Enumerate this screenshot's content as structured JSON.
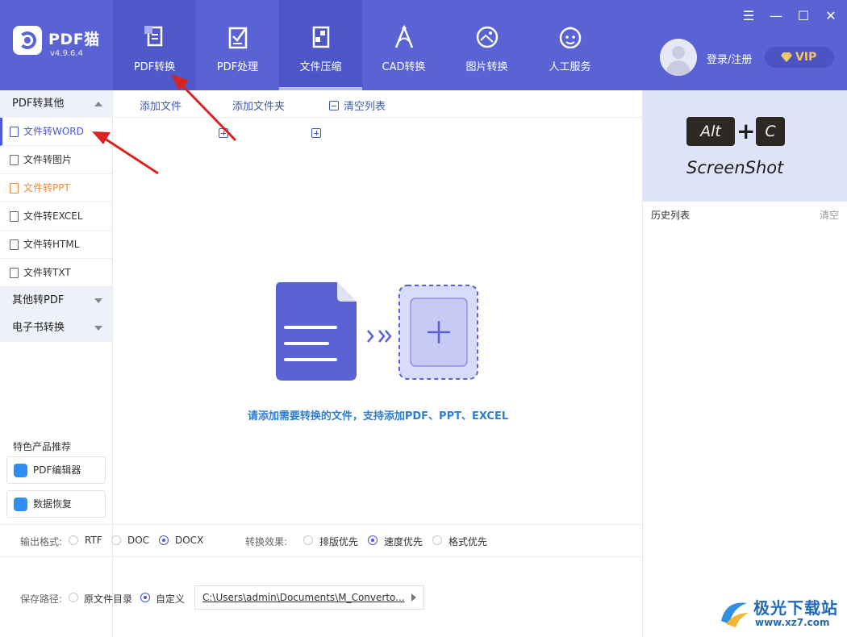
{
  "app": {
    "name": "PDF猫",
    "version": "v4.9.6.4"
  },
  "nav": [
    {
      "label": "PDF转换",
      "icon": "pdf-convert-icon"
    },
    {
      "label": "PDF处理",
      "icon": "pdf-process-icon"
    },
    {
      "label": "文件压缩",
      "icon": "compress-icon"
    },
    {
      "label": "CAD转换",
      "icon": "cad-icon"
    },
    {
      "label": "图片转换",
      "icon": "image-convert-icon"
    },
    {
      "label": "人工服务",
      "icon": "service-icon"
    }
  ],
  "user": {
    "login": "登录/注册",
    "vip": "VIP"
  },
  "window": {
    "menu": "☰",
    "min": "—",
    "max": "☐",
    "close": "✕"
  },
  "sidebar": {
    "section1": "PDF转其他",
    "items": [
      {
        "label": "文件转WORD"
      },
      {
        "label": "文件转图片"
      },
      {
        "label": "文件转PPT"
      },
      {
        "label": "文件转EXCEL"
      },
      {
        "label": "文件转HTML"
      },
      {
        "label": "文件转TXT"
      }
    ],
    "section2": "其他转PDF",
    "section3": "电子书转换",
    "recommend_title": "特色产品推荐",
    "recommend": [
      {
        "label": "PDF编辑器"
      },
      {
        "label": "数据恢复"
      }
    ]
  },
  "toolbar": {
    "add_file": "添加文件",
    "add_folder": "添加文件夹",
    "clear_list": "清空列表"
  },
  "main": {
    "hint": "请添加需要转换的文件，支持添加PDF、PPT、EXCEL"
  },
  "output": {
    "label": "输出格式:",
    "formats": [
      "RTF",
      "DOC",
      "DOCX"
    ],
    "selected_format": "DOCX",
    "effect_label": "转换效果:",
    "effects": [
      "排版优先",
      "速度优先",
      "格式优先"
    ],
    "selected_effect": "速度优先"
  },
  "save": {
    "label": "保存路径:",
    "options": [
      "原文件目录",
      "自定义"
    ],
    "selected": "自定义",
    "path": "C:\\Users\\admin\\Documents\\M_Converto..."
  },
  "right": {
    "key1": "Alt",
    "key2": "C",
    "banner_text": "ScreenShot",
    "history": "历史列表",
    "clear": "清空"
  },
  "watermark": {
    "name": "极光下载站",
    "url": "www.xz7.com"
  },
  "colors": {
    "header": "#5a63d3",
    "accent": "#4f58d8",
    "link": "#2d7fd6",
    "orange": "#f08a3c",
    "annotation": "#d9231f"
  }
}
